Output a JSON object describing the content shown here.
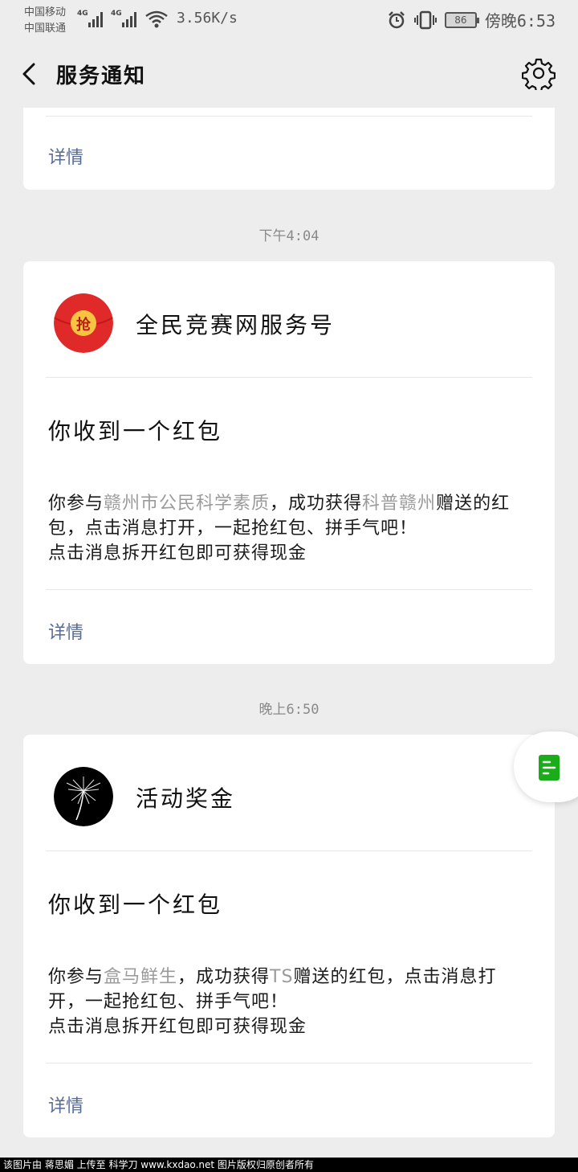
{
  "status_bar": {
    "carrier_1": "中国移动",
    "carrier_2": "中国联通",
    "net_1": "4G",
    "net_2": "4G",
    "speed": "3.56K/s",
    "battery": "86",
    "time": "傍晚6:53"
  },
  "nav": {
    "title": "服务通知"
  },
  "cards": [
    {
      "details_label": "详情"
    },
    {
      "timestamp": "下午4:04",
      "account_name": "全民竞赛网服务号",
      "avatar_char": "抢",
      "title": "你收到一个红包",
      "body_prefix": "你参与",
      "body_hl_1": "赣州市公民科学素质",
      "body_mid": "，成功获得",
      "body_hl_2": "科普赣州",
      "body_suffix": "赠送的红包，点击消息打开，一起抢红包、拼手气吧！",
      "body_line_2": "点击消息拆开红包即可获得现金",
      "details_label": "详情"
    },
    {
      "timestamp": "晚上6:50",
      "account_name": "活动奖金",
      "title": "你收到一个红包",
      "body_prefix": "你参与",
      "body_hl_1": "盒马鲜生",
      "body_mid": "，成功获得",
      "body_hl_2": "TS",
      "body_suffix": "赠送的红包，点击消息打开，一起抢红包、拼手气吧！",
      "body_line_2": "点击消息拆开红包即可获得现金",
      "details_label": "详情"
    }
  ],
  "footer": {
    "text": "该图片由 蒋思媚 上传至 科学刀 www.kxdao.net 图片版权归原创者所有"
  },
  "colors": {
    "link": "#576b95",
    "highlight": "#9b9b9b",
    "red_packet": "#e02a2a",
    "gold": "#f5c542",
    "float_icon": "#1aad19"
  }
}
